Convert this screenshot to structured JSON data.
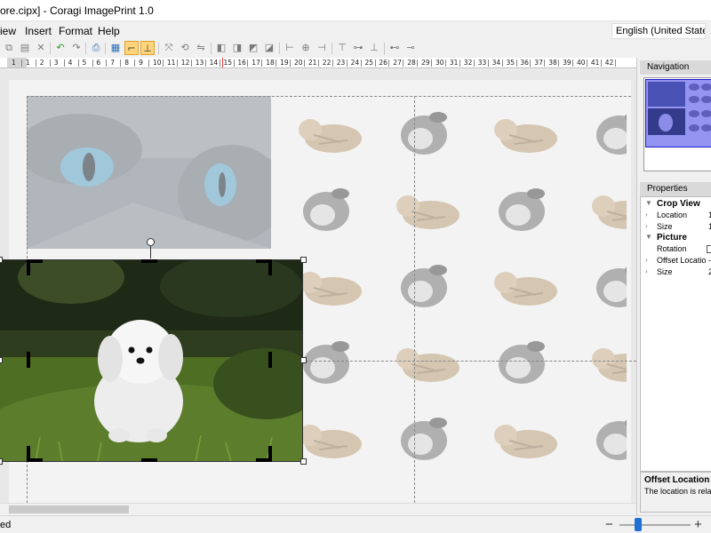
{
  "window": {
    "title": "ore.cipx] - Coragi ImagePrint 1.0"
  },
  "menu": {
    "items": [
      "iew",
      "Insert",
      "Format",
      "Help"
    ]
  },
  "language": {
    "value": "English (United States)"
  },
  "ruler": {
    "ticks": [
      "1",
      "1",
      "2",
      "3",
      "4",
      "5",
      "6",
      "7",
      "8",
      "9",
      "10",
      "11",
      "12",
      "13",
      "14",
      "15",
      "16",
      "17",
      "18",
      "19",
      "20",
      "21",
      "22",
      "23",
      "24",
      "25",
      "26",
      "27",
      "28",
      "29",
      "30",
      "31",
      "32",
      "33",
      "34",
      "35",
      "36",
      "37",
      "38",
      "39",
      "40",
      "41",
      "42"
    ]
  },
  "navigation": {
    "header": "Navigation"
  },
  "properties": {
    "header": "Properties",
    "rows": [
      {
        "type": "category",
        "name": "Crop View"
      },
      {
        "type": "prop",
        "name": "Location",
        "value": "1"
      },
      {
        "type": "prop",
        "name": "Size",
        "value": "1"
      },
      {
        "type": "category",
        "name": "Picture"
      },
      {
        "type": "check",
        "name": "Rotation"
      },
      {
        "type": "prop",
        "name": "Offset Locatio",
        "value": "-"
      },
      {
        "type": "prop",
        "name": "Size",
        "value": "2"
      }
    ],
    "description_title": "Offset Location",
    "description_text": "The location is relati"
  },
  "status": {
    "text": "ed"
  },
  "zoom": {
    "minus": "−",
    "plus": "+"
  },
  "icons": [
    "copy-icon",
    "paste-icon",
    "cut-icon",
    "undo-icon",
    "redo-icon",
    "crop-icon",
    "grid-icon",
    "print-icon",
    "align-left-icon",
    "align-center-icon",
    "align-right-icon",
    "distribute-icon"
  ]
}
